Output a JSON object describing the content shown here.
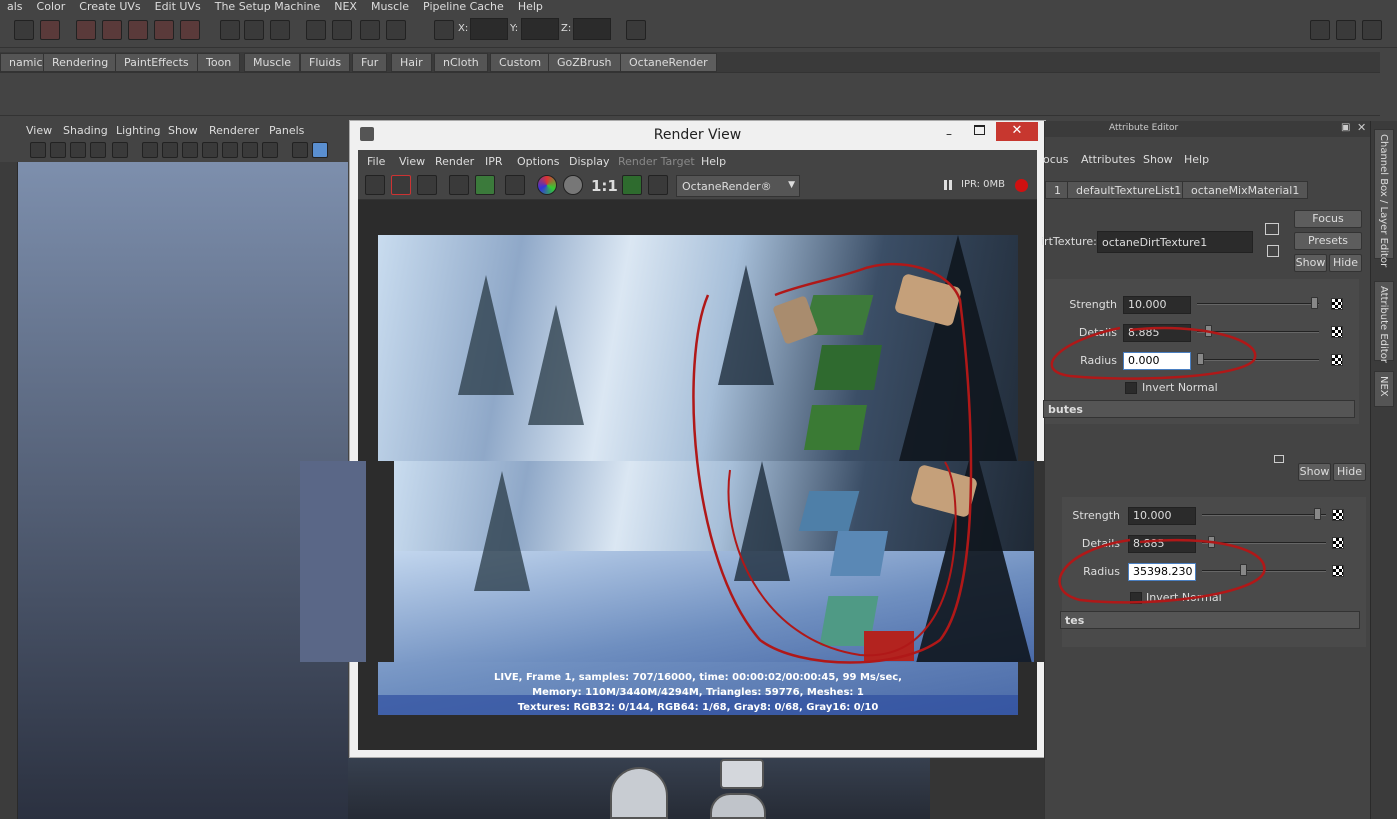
{
  "menubar": {
    "items": [
      "als",
      "Color",
      "Create UVs",
      "Edit UVs",
      "The Setup Machine",
      "NEX",
      "Muscle",
      "Pipeline Cache",
      "Help"
    ]
  },
  "toolbar": {
    "x_label": "X:",
    "y_label": "Y:",
    "z_label": "Z:"
  },
  "shelf": {
    "tabs": [
      "namics",
      "Rendering",
      "PaintEffects",
      "Toon",
      "Muscle",
      "Fluids",
      "Fur",
      "Hair",
      "nCloth",
      "Custom",
      "GoZBrush",
      "OctaneRender"
    ],
    "active": "OctaneRender"
  },
  "viewport": {
    "menu": [
      "View",
      "Shading",
      "Lighting",
      "Show",
      "Renderer",
      "Panels"
    ]
  },
  "render_view": {
    "title": "Render View",
    "menu": [
      "File",
      "View",
      "Render",
      "IPR",
      "Options",
      "Display",
      "Render Target",
      "Help"
    ],
    "zoom_label": "1:1",
    "renderer": "OctaneRender®",
    "ipr_status": "IPR: 0MB",
    "status_lines": [
      "LIVE, Frame 1, samples: 707/16000, time: 00:00:02/00:00:45, 99 Ms/sec,",
      "Memory: 110M/3440M/4294M, Triangles: 59776, Meshes: 1",
      "Textures: RGB32: 0/144, RGB64: 1/68, Gray8: 0/68, Gray16: 0/10"
    ]
  },
  "attribute_editor": {
    "title": "Attribute Editor",
    "menu": [
      "ocus",
      "Attributes",
      "Show",
      "Help"
    ],
    "tabs": [
      "1",
      "defaultTextureList1",
      "octaneMixMaterial1"
    ],
    "node_label": "irtTexture:",
    "node_name": "octaneDirtTexture1",
    "focus_label": "Focus",
    "presets_label": "Presets",
    "show_label": "Show",
    "hide_label": "Hide",
    "strength_label": "Strength",
    "strength_value": "10.000",
    "details_label": "Details",
    "details_value": "8.885",
    "radius_label": "Radius",
    "radius_value": "0.000",
    "invert_label": "Invert Normal",
    "section_label": "butes",
    "second": {
      "show_label": "Show",
      "hide_label": "Hide",
      "strength_label": "Strength",
      "strength_value": "10.000",
      "details_label": "Details",
      "details_value": "8.885",
      "radius_label": "Radius",
      "radius_value": "35398.230",
      "invert_label": "Invert Normal",
      "section_label": "tes"
    }
  },
  "sidebar": {
    "tabs": [
      "Channel Box / Layer Editor",
      "Attribute Editor",
      "NEX"
    ]
  },
  "colors": {
    "annotation": "#b01818",
    "accent": "#4a7fc1"
  }
}
